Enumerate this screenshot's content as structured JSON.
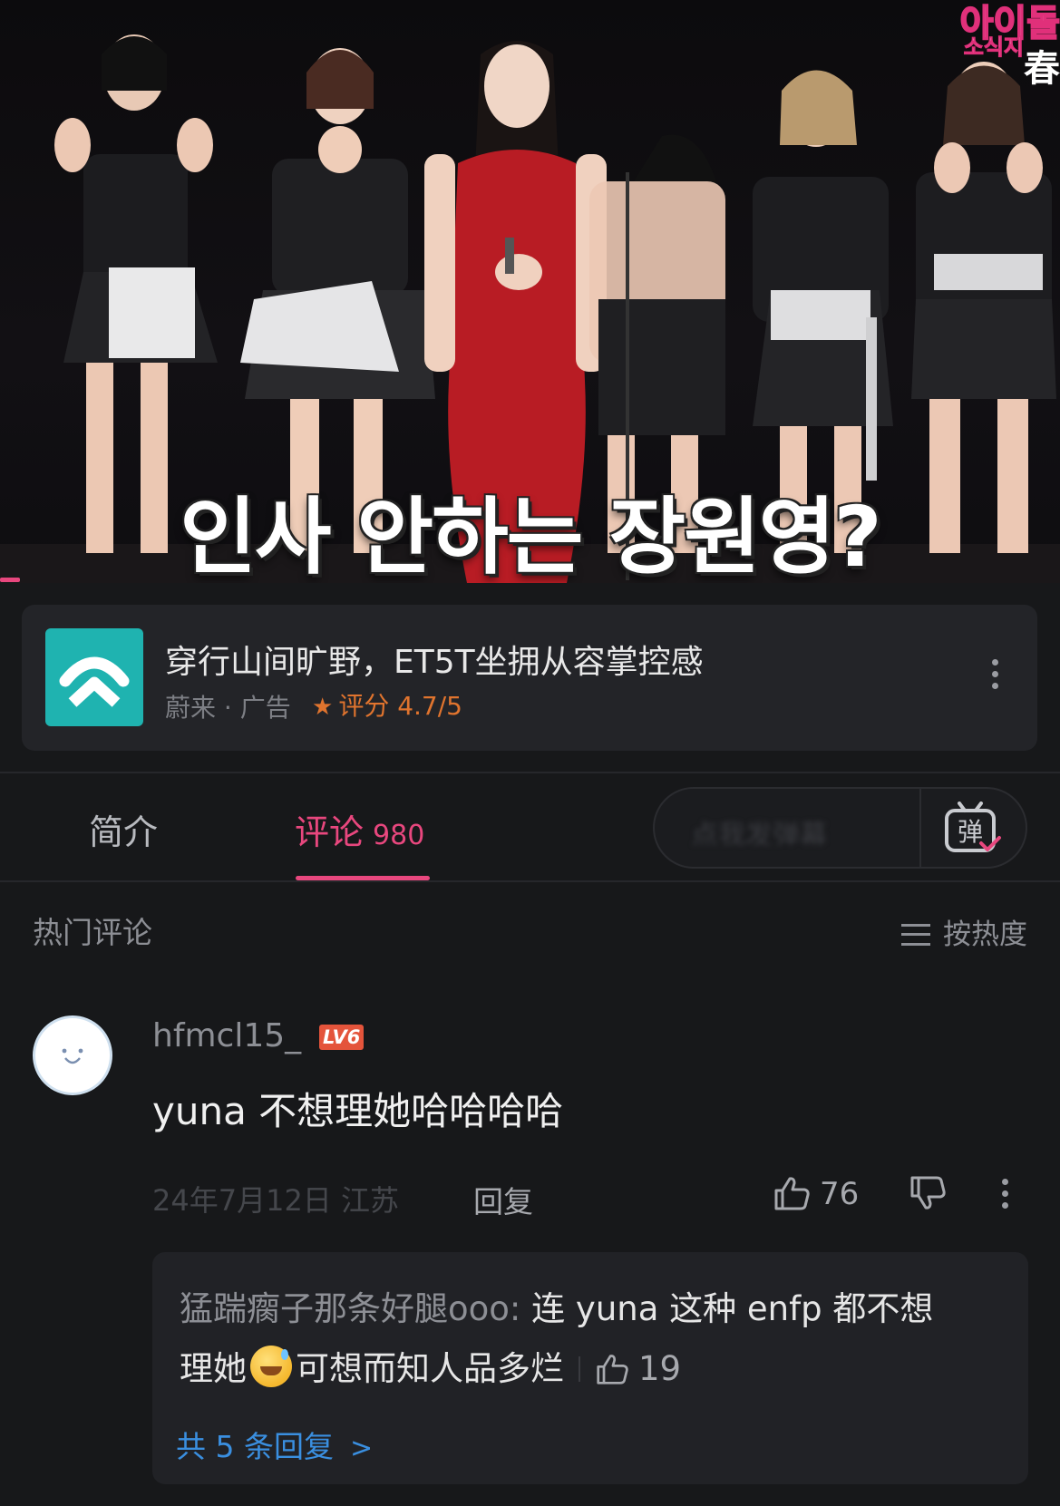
{
  "video": {
    "caption": "인사 안하는 장원영?",
    "channel_mark": "아이돌",
    "channel_sub": "소식지",
    "channel_cjk": "春"
  },
  "ad": {
    "title": "穿行山间旷野，ET5T坐拥从容掌控感",
    "advertiser": "蔚来 · 广告",
    "rating": "评分 4.7/5",
    "logo_icon": "nio-logo",
    "accent": "#1fb3b0"
  },
  "tabs": {
    "intro": "简介",
    "comments": "评论",
    "comments_count": "980",
    "danmaku_placeholder": "点我发弹幕",
    "active_color": "#e8477e"
  },
  "comments_header": {
    "title": "热门评论",
    "sort_label": "按热度"
  },
  "comment": {
    "username": "hfmcl15_",
    "level": "LV6",
    "text": "yuna 不想理她哈哈哈哈",
    "date_location": "24年7月12日 江苏",
    "reply_label": "回复",
    "likes": "76"
  },
  "replies": {
    "author": "猛踹瘸子那条好腿ooo:",
    "text_line1": "连 yuna 这种 enfp 都不想",
    "text_line2a": "理她",
    "text_line2b": "可想而知人品多烂",
    "likes": "19",
    "more_label": "共 5 条回复",
    "more_color": "#3a8fe0"
  }
}
